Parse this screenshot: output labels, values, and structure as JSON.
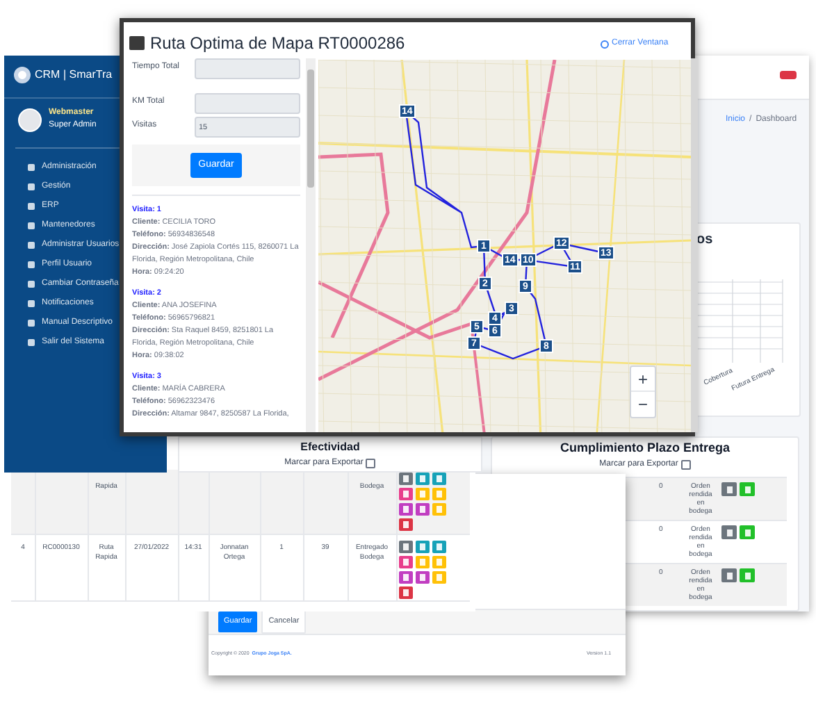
{
  "dashboard": {
    "breadcrumb": [
      "Inicio",
      "/",
      "Dashboard"
    ],
    "chart_card": {
      "title": "os",
      "axis_labels": [
        "Cobertura",
        "Futura Entrega"
      ]
    },
    "delivery_card": {
      "title": "Cumplimiento Plazo Entrega",
      "export_label": "Marcar para Exportar",
      "export_checked": false,
      "rows": [
        {
          "value": "0",
          "status": "Orden rendida en bodega",
          "buttons": [
            {
              "color": "#6c757d"
            },
            {
              "color": "#22c02a"
            }
          ]
        },
        {
          "value": "0",
          "status": "Orden rendida en bodega",
          "buttons": [
            {
              "color": "#6c757d"
            },
            {
              "color": "#22c02a"
            }
          ]
        },
        {
          "value": "0",
          "status": "Orden rendida en bodega",
          "buttons": [
            {
              "color": "#6c757d"
            },
            {
              "color": "#22c02a"
            }
          ]
        }
      ]
    }
  },
  "sidebar": {
    "brand": "CRM | SmarTra",
    "user": {
      "name": "Webmaster",
      "role": "Super Admin"
    },
    "items": [
      "Administración",
      "Gestión",
      "ERP",
      "Mantenedores",
      "Administrar Usuarios",
      "Perfil Usuario",
      "Cambiar Contraseña",
      "Notificaciones",
      "Manual Descriptivo",
      "Salir del Sistema"
    ]
  },
  "orders_table": {
    "rows": [
      {
        "cells": [
          "",
          "",
          "Rapida",
          "",
          "",
          "",
          "",
          "",
          "Bodega"
        ],
        "buttons": [
          {
            "color": "#6c757d"
          },
          {
            "color": "#17a2b8"
          },
          {
            "color": "#17a2b8"
          },
          {
            "color": "#e83e8c"
          },
          {
            "color": "#ffc107"
          },
          {
            "color": "#ffc107"
          },
          {
            "color": "#c13ec1"
          },
          {
            "color": "#c13ec1"
          },
          {
            "color": "#ffc107"
          },
          {
            "color": "#dc3545"
          }
        ]
      },
      {
        "cells": [
          "4",
          "RC0000130",
          "Ruta Rapida",
          "27/01/2022",
          "14:31",
          "Jonnatan Ortega",
          "1",
          "39",
          "Entregado Bodega"
        ],
        "buttons": [
          {
            "color": "#6c757d"
          },
          {
            "color": "#17a2b8"
          },
          {
            "color": "#17a2b8"
          },
          {
            "color": "#e83e8c"
          },
          {
            "color": "#ffc107"
          },
          {
            "color": "#ffc107"
          },
          {
            "color": "#c13ec1"
          },
          {
            "color": "#c13ec1"
          },
          {
            "color": "#ffc107"
          },
          {
            "color": "#dc3545"
          }
        ]
      }
    ]
  },
  "form_window": {
    "buttons": [
      "Guardar",
      "Cancelar"
    ],
    "copyright": "Copyright © 2020",
    "company": "Grupo Joga SpA.",
    "version": "Version 1.1"
  },
  "effectiveness_card": {
    "title": "Efectividad",
    "export_label": "Marcar para Exportar",
    "export_checked": false
  },
  "modal": {
    "title": "Ruta Optima de Mapa RT0000286",
    "close_label": "Cerrar Ventana",
    "fields": [
      {
        "label": "Tiempo Total"
      },
      {
        "label": "KM Total"
      },
      {
        "label": "Visitas",
        "value": "15"
      }
    ],
    "save_label": "Guardar",
    "visits": [
      {
        "heading": "Visita: 1",
        "lines": [
          "**Cliente:** CECILIA TORO",
          "**Teléfono:** 56934836548",
          "**Dirección:** José Zapiola Cortés 115, 8260071 La Florida, Región Metropolitana, Chile",
          "**Hora:** 09:24:20"
        ]
      },
      {
        "heading": "Visita: 2",
        "lines": [
          "**Cliente:** ANA JOSEFINA",
          "**Teléfono:** 56965796821",
          "**Dirección:** Sta Raquel 8459, 8251801 La Florida, Región Metropolitana, Chile",
          "**Hora:** 09:38:02"
        ]
      },
      {
        "heading": "Visita: 3",
        "lines": [
          "**Cliente:** MARÍA CABRERA",
          "**Teléfono:** 56962323476",
          "**Dirección:** Altamar 9847, 8250587 La Florida,"
        ]
      }
    ],
    "map": {
      "markers": [
        "14",
        "1",
        "14",
        "10",
        "12",
        "13",
        "11",
        "2",
        "9",
        "3",
        "4",
        "5",
        "6",
        "7",
        "8"
      ],
      "zoom_controls": [
        "+",
        "−"
      ]
    }
  }
}
